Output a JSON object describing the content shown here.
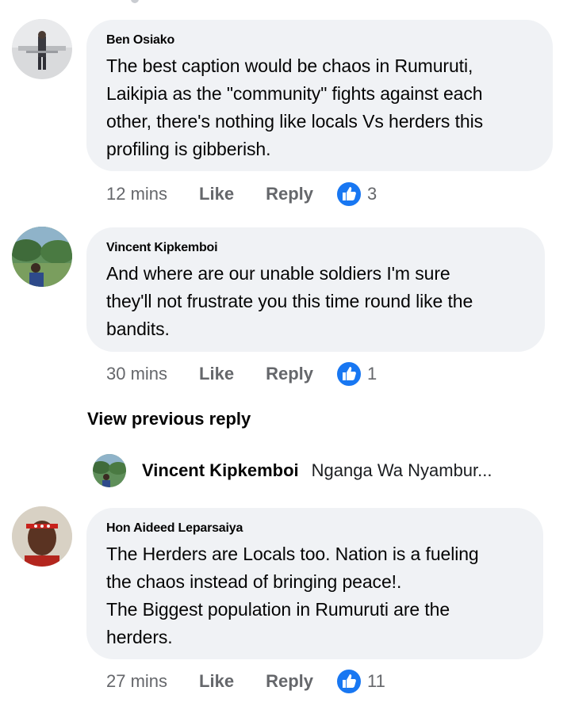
{
  "comments": [
    {
      "author": "Ben Osiako",
      "text": "The best caption would be chaos in Rumuruti,\nLaikipia as the \"community\" fights against each\nother, there's nothing like locals Vs herders this\nprofiling is gibberish.",
      "time": "12 mins",
      "like_label": "Like",
      "reply_label": "Reply",
      "reaction_count": "3",
      "reaction_icon": "thumbs-up-icon"
    },
    {
      "author": "Vincent Kipkemboi",
      "text": "And where are our unable soldiers I'm sure\nthey'll not frustrate you this time round like the\nbandits.",
      "time": "30 mins",
      "like_label": "Like",
      "reply_label": "Reply",
      "reaction_count": "1",
      "reaction_icon": "thumbs-up-icon"
    },
    {
      "author": "Hon Aideed Leparsaiya",
      "text": "The Herders are Locals too. Nation is a fueling\nthe chaos instead of bringing peace!.\nThe Biggest population in Rumuruti are the\nherders.",
      "time": "27 mins",
      "like_label": "Like",
      "reply_label": "Reply",
      "reaction_count": "11",
      "reaction_icon": "thumbs-up-icon"
    }
  ],
  "replies": {
    "view_previous_label": "View previous reply",
    "preview": {
      "author": "Vincent Kipkemboi",
      "text": "Nganga Wa Nyambur..."
    }
  },
  "colors": {
    "bubble_bg": "#f0f2f5",
    "muted_text": "#65676b",
    "like_blue": "#1877f2"
  }
}
